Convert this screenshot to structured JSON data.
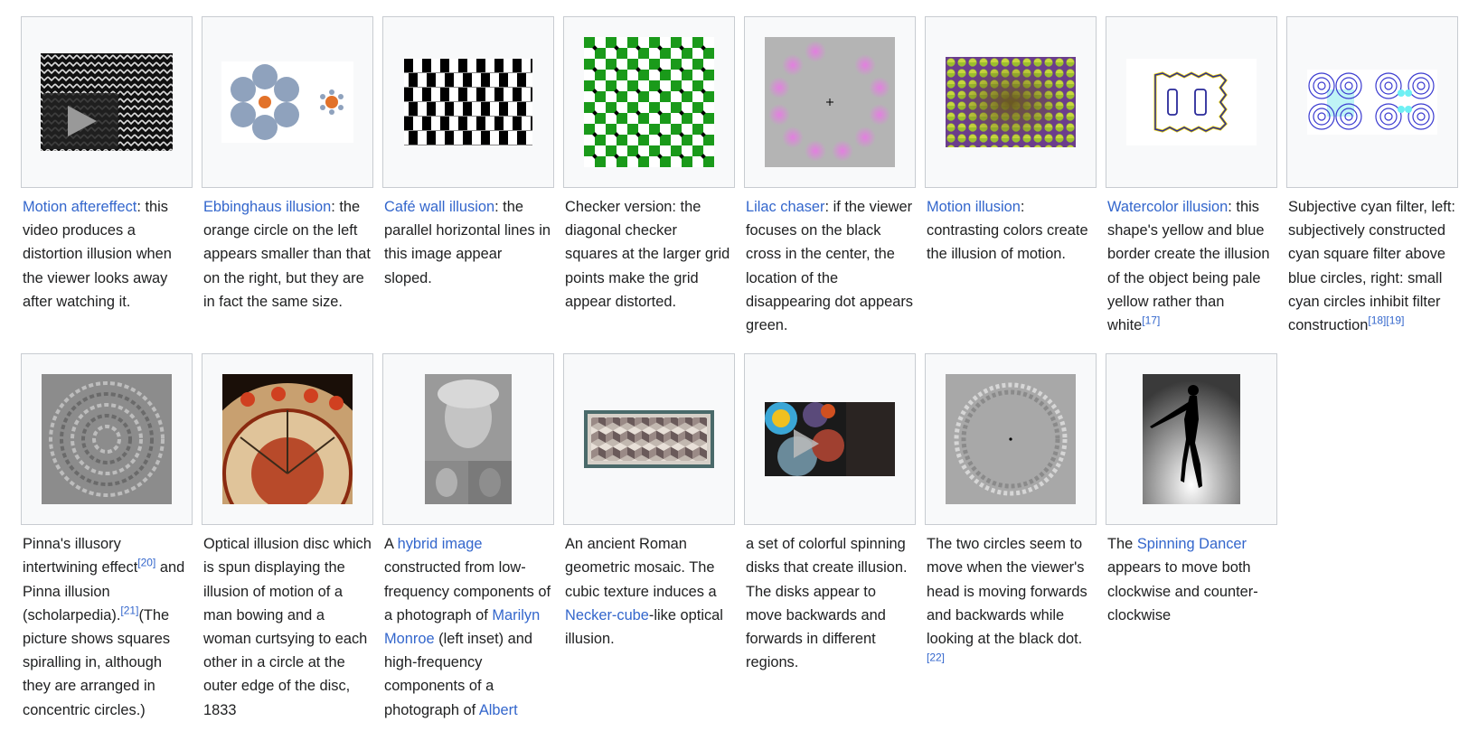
{
  "row1": [
    {
      "link": "Motion aftereffect",
      "text": ": this video produces a distortion illusion when the viewer looks away after watching it."
    },
    {
      "link": "Ebbinghaus illusion",
      "text": ": the orange circle on the left appears smaller than that on the right, but they are in fact the same size."
    },
    {
      "link": "Café wall illusion",
      "text": ": the parallel horizontal lines in this image appear sloped."
    },
    {
      "text": "Checker version: the diagonal checker squares at the larger grid points make the grid appear distorted."
    },
    {
      "link": "Lilac chaser",
      "text": ": if the viewer focuses on the black cross in the center, the location of the disappearing dot appears green."
    },
    {
      "link": "Motion illusion",
      "text": ": contrasting colors create the illusion of motion."
    },
    {
      "link": "Watercolor illusion",
      "text": ": this shape's yellow and blue border create the illusion of the object being pale yellow rather than white",
      "refs": [
        "[17]"
      ]
    },
    {
      "text": "Subjective cyan filter, left: subjectively constructed cyan square filter above blue circles, right: small cyan circles inhibit filter construction",
      "refs": [
        "[18]",
        "[19]"
      ]
    }
  ],
  "row2": [
    {
      "a": "Pinna's illusory intertwining effect",
      "ref1": "[20]",
      "b": " and Pinna illusion (scholarpedia).",
      "ref2": "[21]",
      "c": "(The picture shows squares spiralling in, although they are arranged in concentric circles.)"
    },
    {
      "text": "Optical illusion disc which is spun displaying the illusion of motion of a man bowing and a woman curtsying to each other in a circle at the outer edge of the disc, 1833"
    },
    {
      "pre": "A ",
      "link1": "hybrid image",
      "mid": " constructed from low-frequency components of a photograph of ",
      "link2": "Marilyn Monroe",
      "mid2": " (left inset) and high-frequency components of a photograph of ",
      "link3": "Albert"
    },
    {
      "pre": "An ancient Roman geometric mosaic. The cubic texture induces a ",
      "link": "Necker-cube",
      "post": "-like optical illusion."
    },
    {
      "text": "a set of colorful spinning disks that create illusion. The disks appear to move backwards and forwards in different regions."
    },
    {
      "text": "The two circles seem to move when the viewer's head is moving forwards and backwards while looking at the black dot.",
      "ref": "[22]"
    },
    {
      "pre": "The ",
      "link": "Spinning Dancer",
      "post": " appears to move both clockwise and counter-clockwise"
    }
  ],
  "icons": [
    "play-icon",
    "cross-icon"
  ],
  "colors": {
    "link": "#3366cc",
    "border": "#c8ccd1",
    "thumb_bg": "#f8f9fa",
    "text": "#202122"
  }
}
